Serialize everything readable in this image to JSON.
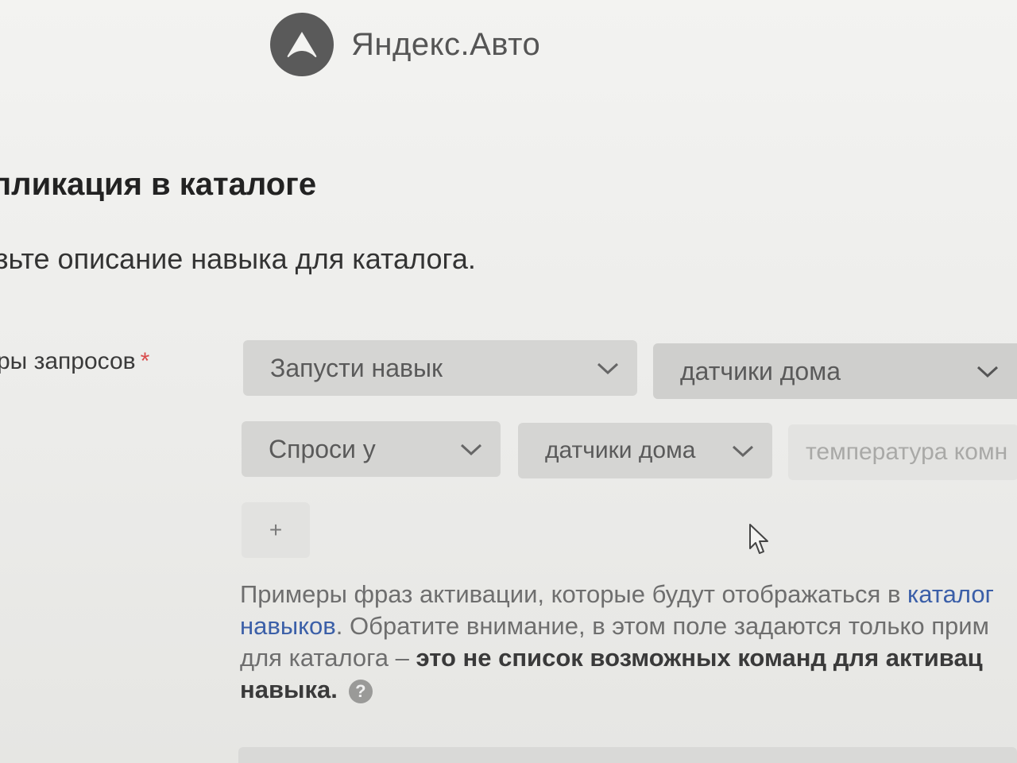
{
  "brand": {
    "name": "Яндекс.Авто",
    "logo_icon": "yandex-auto-logo-icon",
    "logo_color": "#5a5a5a"
  },
  "section": {
    "title": "пликация в каталоге",
    "description": "зьте описание навыка для каталога."
  },
  "field": {
    "label": "ры запросов",
    "required_mark": "*"
  },
  "rows": [
    {
      "selects": [
        "Запусти навык",
        "датчики дома"
      ]
    },
    {
      "selects": [
        "Спроси у",
        "датчики дома"
      ],
      "input_value": "температура комн"
    }
  ],
  "add_button": {
    "label": "+"
  },
  "help": {
    "text1": "Примеры фраз активации, которые будут отображаться в ",
    "link1": "каталог",
    "link2": "навыков",
    "text2": ". Обратите внимание, в этом поле задаются только прим",
    "text3": "для каталога – ",
    "bold1": "это не список возможных команд для активац",
    "bold2": "навыка.",
    "help_icon": "?"
  },
  "colors": {
    "required": "#d94b4b",
    "link": "#3b5fa8",
    "select_bg": "#d5d5d3"
  }
}
